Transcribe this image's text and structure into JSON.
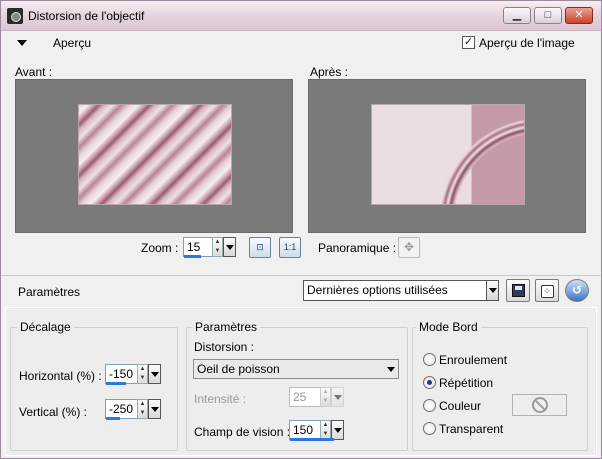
{
  "window": {
    "title": "Distorsion de l'objectif",
    "buttons": {
      "minimize": "▁",
      "maximize": "□",
      "close": "✕"
    }
  },
  "preview_toggle": {
    "label": "Aperçu"
  },
  "image_preview": {
    "label": "Aperçu de l'image",
    "checked": true
  },
  "panes": {
    "before_label": "Avant :",
    "after_label": "Après :"
  },
  "zoom": {
    "label": "Zoom :",
    "value": "15",
    "btn_fit": "⊡",
    "btn_actual": "1:1"
  },
  "panoramic": {
    "label": "Panoramique :",
    "icon": "✥"
  },
  "presets": {
    "label": "Paramètres",
    "selected": "Dernières options utilisées"
  },
  "offset_group": {
    "title": "Décalage",
    "horizontal_label": "Horizontal (%) :",
    "horizontal_value": "-150",
    "vertical_label": "Vertical (%) :",
    "vertical_value": "-250"
  },
  "params_group": {
    "title": "Paramètres",
    "distortion_label": "Distorsion :",
    "distortion_value": "Oeil de poisson",
    "intensity_label": "Intensité :",
    "intensity_value": "25",
    "fov_label": "Champ de vision :",
    "fov_value": "150"
  },
  "edge_group": {
    "title": "Mode Bord",
    "options": [
      "Enroulement",
      "Répétition",
      "Couleur",
      "Transparent"
    ],
    "selected": "Répétition"
  },
  "icons": {
    "collapse": "triangle-down-icon",
    "save": "save-icon",
    "randomize": "dice-icon",
    "reset": "reset-icon",
    "no_color": "no-color-icon"
  }
}
